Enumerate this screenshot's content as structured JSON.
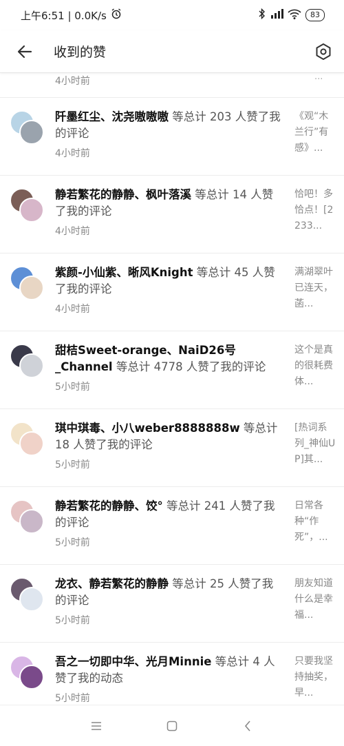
{
  "status_bar": {
    "time_speed": "上午6:51 | 0.0K/s",
    "battery": "83"
  },
  "header": {
    "title": "收到的赞"
  },
  "first_partial": {
    "time": "4小时前",
    "preview_tail": "..."
  },
  "items": [
    {
      "names": "阡墨红尘、沈尧嗷嗷嗷",
      "suffix": " 等总计 203 人赞了我的评论",
      "time": "4小时前",
      "preview": "《观“木兰行”有感》...",
      "av_back": "#b8d4e6",
      "av_front": "#9aa3ad"
    },
    {
      "names": "静若繁花的静静、枫叶落溪",
      "suffix": " 等总计 14 人赞了我的评论",
      "time": "4小时前",
      "preview": "恰吧！多恰点！[2233...",
      "av_back": "#7b5e57",
      "av_front": "#d7b6c9"
    },
    {
      "names": "紫颜-小仙紫、晰风Knight",
      "suffix": " 等总计 45 人赞了我的评论",
      "time": "4小时前",
      "preview": "满湖翠叶已连天，菡...",
      "av_back": "#5d8fd6",
      "av_front": "#e8d6c4"
    },
    {
      "names": "甜桔Sweet-orange、NaiD26号_Channel",
      "suffix": " 等总计 4778 人赞了我的评论",
      "time": "5小时前",
      "preview": "这个是真的很耗费体...",
      "av_back": "#3a3a4a",
      "av_front": "#cfd2d8"
    },
    {
      "names": "琪中琪毒、小八weber8888888w",
      "suffix": " 等总计 18 人赞了我的评论",
      "time": "5小时前",
      "preview": "[热词系列_神仙UP]其...",
      "av_back": "#f2e3c9",
      "av_front": "#f0d2c8"
    },
    {
      "names": "静若繁花的静静、饺°",
      "suffix": "  等总计 241 人赞了我的评论",
      "time": "5小时前",
      "preview": "日常各种“作死”，...",
      "av_back": "#e6c4c4",
      "av_front": "#c9b7c8"
    },
    {
      "names": "龙衣、静若繁花的静静",
      "suffix": " 等总计 25 人赞了我的评论",
      "time": "5小时前",
      "preview": "朋友知道什么是幸福...",
      "av_back": "#6a5a6e",
      "av_front": "#dfe6ef"
    },
    {
      "names": "吾之一切即中华、光月Minnie",
      "suffix": " 等总计 4 人赞了我的动态",
      "time": "5小时前",
      "preview": "只要我坚持抽奖，早...",
      "av_back": "#d9b6e6",
      "av_front": "#7a4a8a"
    }
  ]
}
